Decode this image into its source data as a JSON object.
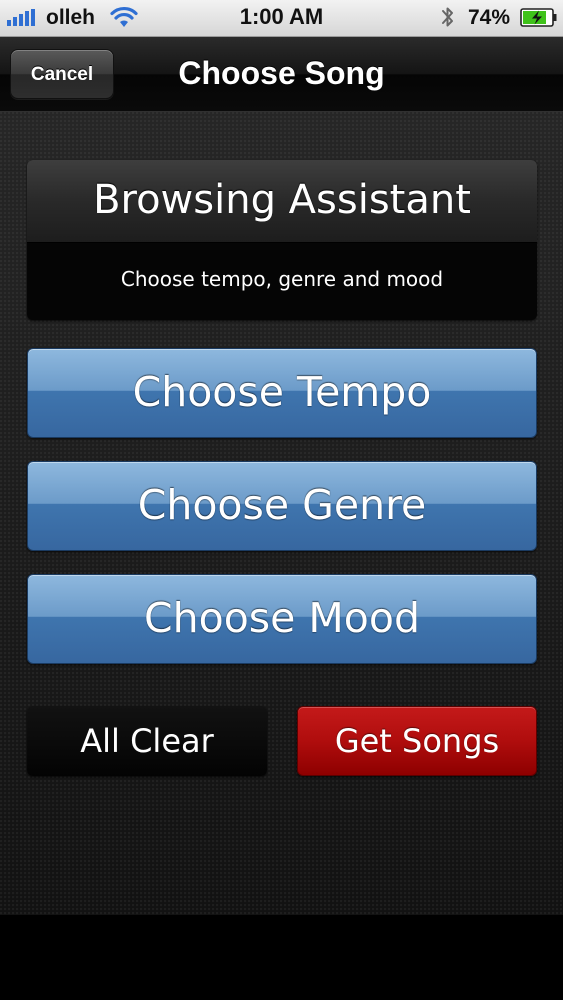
{
  "status_bar": {
    "carrier": "olleh",
    "time": "1:00 AM",
    "battery_percent": "74%",
    "signal_icon": "signal-bars-icon",
    "wifi_icon": "wifi-icon",
    "bluetooth_icon": "bluetooth-icon",
    "battery_icon": "battery-charging-icon"
  },
  "nav_bar": {
    "cancel_label": "Cancel",
    "title": "Choose Song"
  },
  "assistant": {
    "title": "Browsing Assistant",
    "subtitle": "Choose tempo, genre and mood"
  },
  "options": {
    "tempo_label": "Choose Tempo",
    "genre_label": "Choose Genre",
    "mood_label": "Choose Mood"
  },
  "actions": {
    "clear_label": "All Clear",
    "get_songs_label": "Get Songs"
  },
  "colors": {
    "option_blue": "#4a80b8",
    "get_songs_red": "#b00d0d",
    "battery_green": "#3fc21a"
  }
}
